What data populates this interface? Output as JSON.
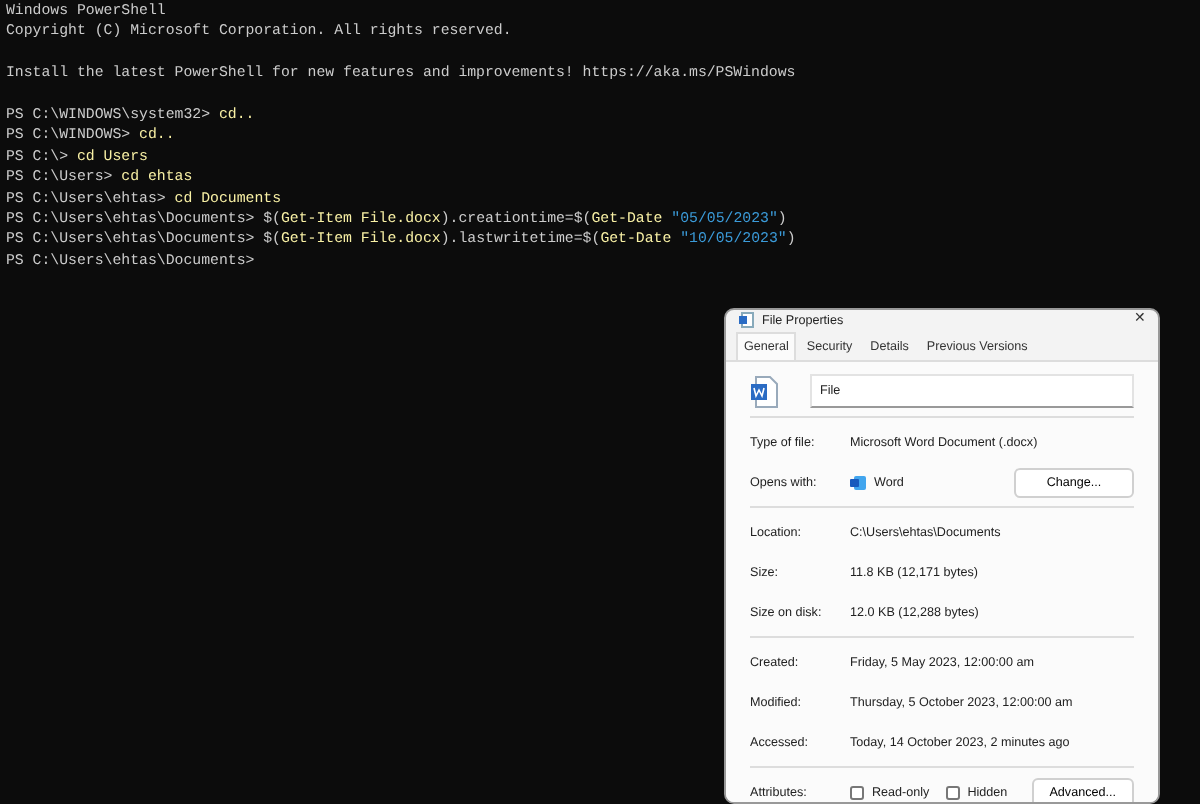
{
  "terminal": {
    "lines": [
      [
        {
          "kind": "plain",
          "text": "Windows PowerShell"
        }
      ],
      [
        {
          "kind": "plain",
          "text": "Copyright (C) Microsoft Corporation. All rights reserved."
        }
      ],
      {
        "kind": "blank"
      },
      [
        {
          "kind": "plain",
          "text": "Install the latest PowerShell for new features and improvements! https://aka.ms/PSWindows"
        }
      ],
      {
        "kind": "blank"
      },
      [
        {
          "kind": "plain",
          "text": "PS C:\\WINDOWS\\system32> "
        },
        {
          "kind": "cmd",
          "text": "cd.."
        }
      ],
      [
        {
          "kind": "plain",
          "text": "PS C:\\WINDOWS> "
        },
        {
          "kind": "cmd",
          "text": "cd.."
        }
      ],
      [
        {
          "kind": "plain",
          "text": "PS C:\\> "
        },
        {
          "kind": "cmd",
          "text": "cd Users"
        }
      ],
      [
        {
          "kind": "plain",
          "text": "PS C:\\Users> "
        },
        {
          "kind": "cmd",
          "text": "cd ehtas"
        }
      ],
      [
        {
          "kind": "plain",
          "text": "PS C:\\Users\\ehtas> "
        },
        {
          "kind": "cmd",
          "text": "cd Documents"
        }
      ],
      [
        {
          "kind": "plain",
          "text": "PS C:\\Users\\ehtas\\Documents> $("
        },
        {
          "kind": "cmd",
          "text": "Get-Item File.docx"
        },
        {
          "kind": "plain",
          "text": ").creationtime=$("
        },
        {
          "kind": "cmd",
          "text": "Get-Date "
        },
        {
          "kind": "str",
          "text": "\"05/05/2023\""
        },
        {
          "kind": "plain",
          "text": ")"
        }
      ],
      [
        {
          "kind": "plain",
          "text": "PS C:\\Users\\ehtas\\Documents> $("
        },
        {
          "kind": "cmd",
          "text": "Get-Item File.docx"
        },
        {
          "kind": "plain",
          "text": ").lastwritetime=$("
        },
        {
          "kind": "cmd",
          "text": "Get-Date "
        },
        {
          "kind": "str",
          "text": "\"10/05/2023\""
        },
        {
          "kind": "plain",
          "text": ")"
        }
      ],
      [
        {
          "kind": "plain",
          "text": "PS C:\\Users\\ehtas\\Documents>"
        }
      ]
    ]
  },
  "dialog": {
    "title": "File Properties",
    "close": "✕",
    "tabs": [
      {
        "label": "General",
        "selected": true
      },
      {
        "label": "Security",
        "selected": false
      },
      {
        "label": "Details",
        "selected": false
      },
      {
        "label": "Previous Versions",
        "selected": false
      }
    ],
    "file_name": "File",
    "groups": [
      [
        {
          "kind": "text",
          "label": "Type of file:",
          "value": "Microsoft Word Document (.docx)"
        },
        {
          "kind": "opens",
          "label": "Opens with:",
          "value": "Word",
          "button": "Change..."
        }
      ],
      [
        {
          "kind": "text",
          "label": "Location:",
          "value": "C:\\Users\\ehtas\\Documents"
        },
        {
          "kind": "text",
          "label": "Size:",
          "value": "11.8 KB (12,171 bytes)"
        },
        {
          "kind": "text",
          "label": "Size on disk:",
          "value": "12.0 KB (12,288 bytes)"
        }
      ],
      [
        {
          "kind": "text",
          "label": "Created:",
          "value": "Friday, 5 May 2023, 12:00:00 am"
        },
        {
          "kind": "text",
          "label": "Modified:",
          "value": "Thursday, 5 October 2023, 12:00:00 am"
        },
        {
          "kind": "text",
          "label": "Accessed:",
          "value": "Today, 14 October 2023, 2 minutes ago"
        }
      ],
      [
        {
          "kind": "attrs",
          "label": "Attributes:",
          "checks": [
            {
              "label": "Read-only",
              "checked": false
            },
            {
              "label": "Hidden",
              "checked": false
            }
          ],
          "button": "Advanced..."
        }
      ]
    ]
  }
}
